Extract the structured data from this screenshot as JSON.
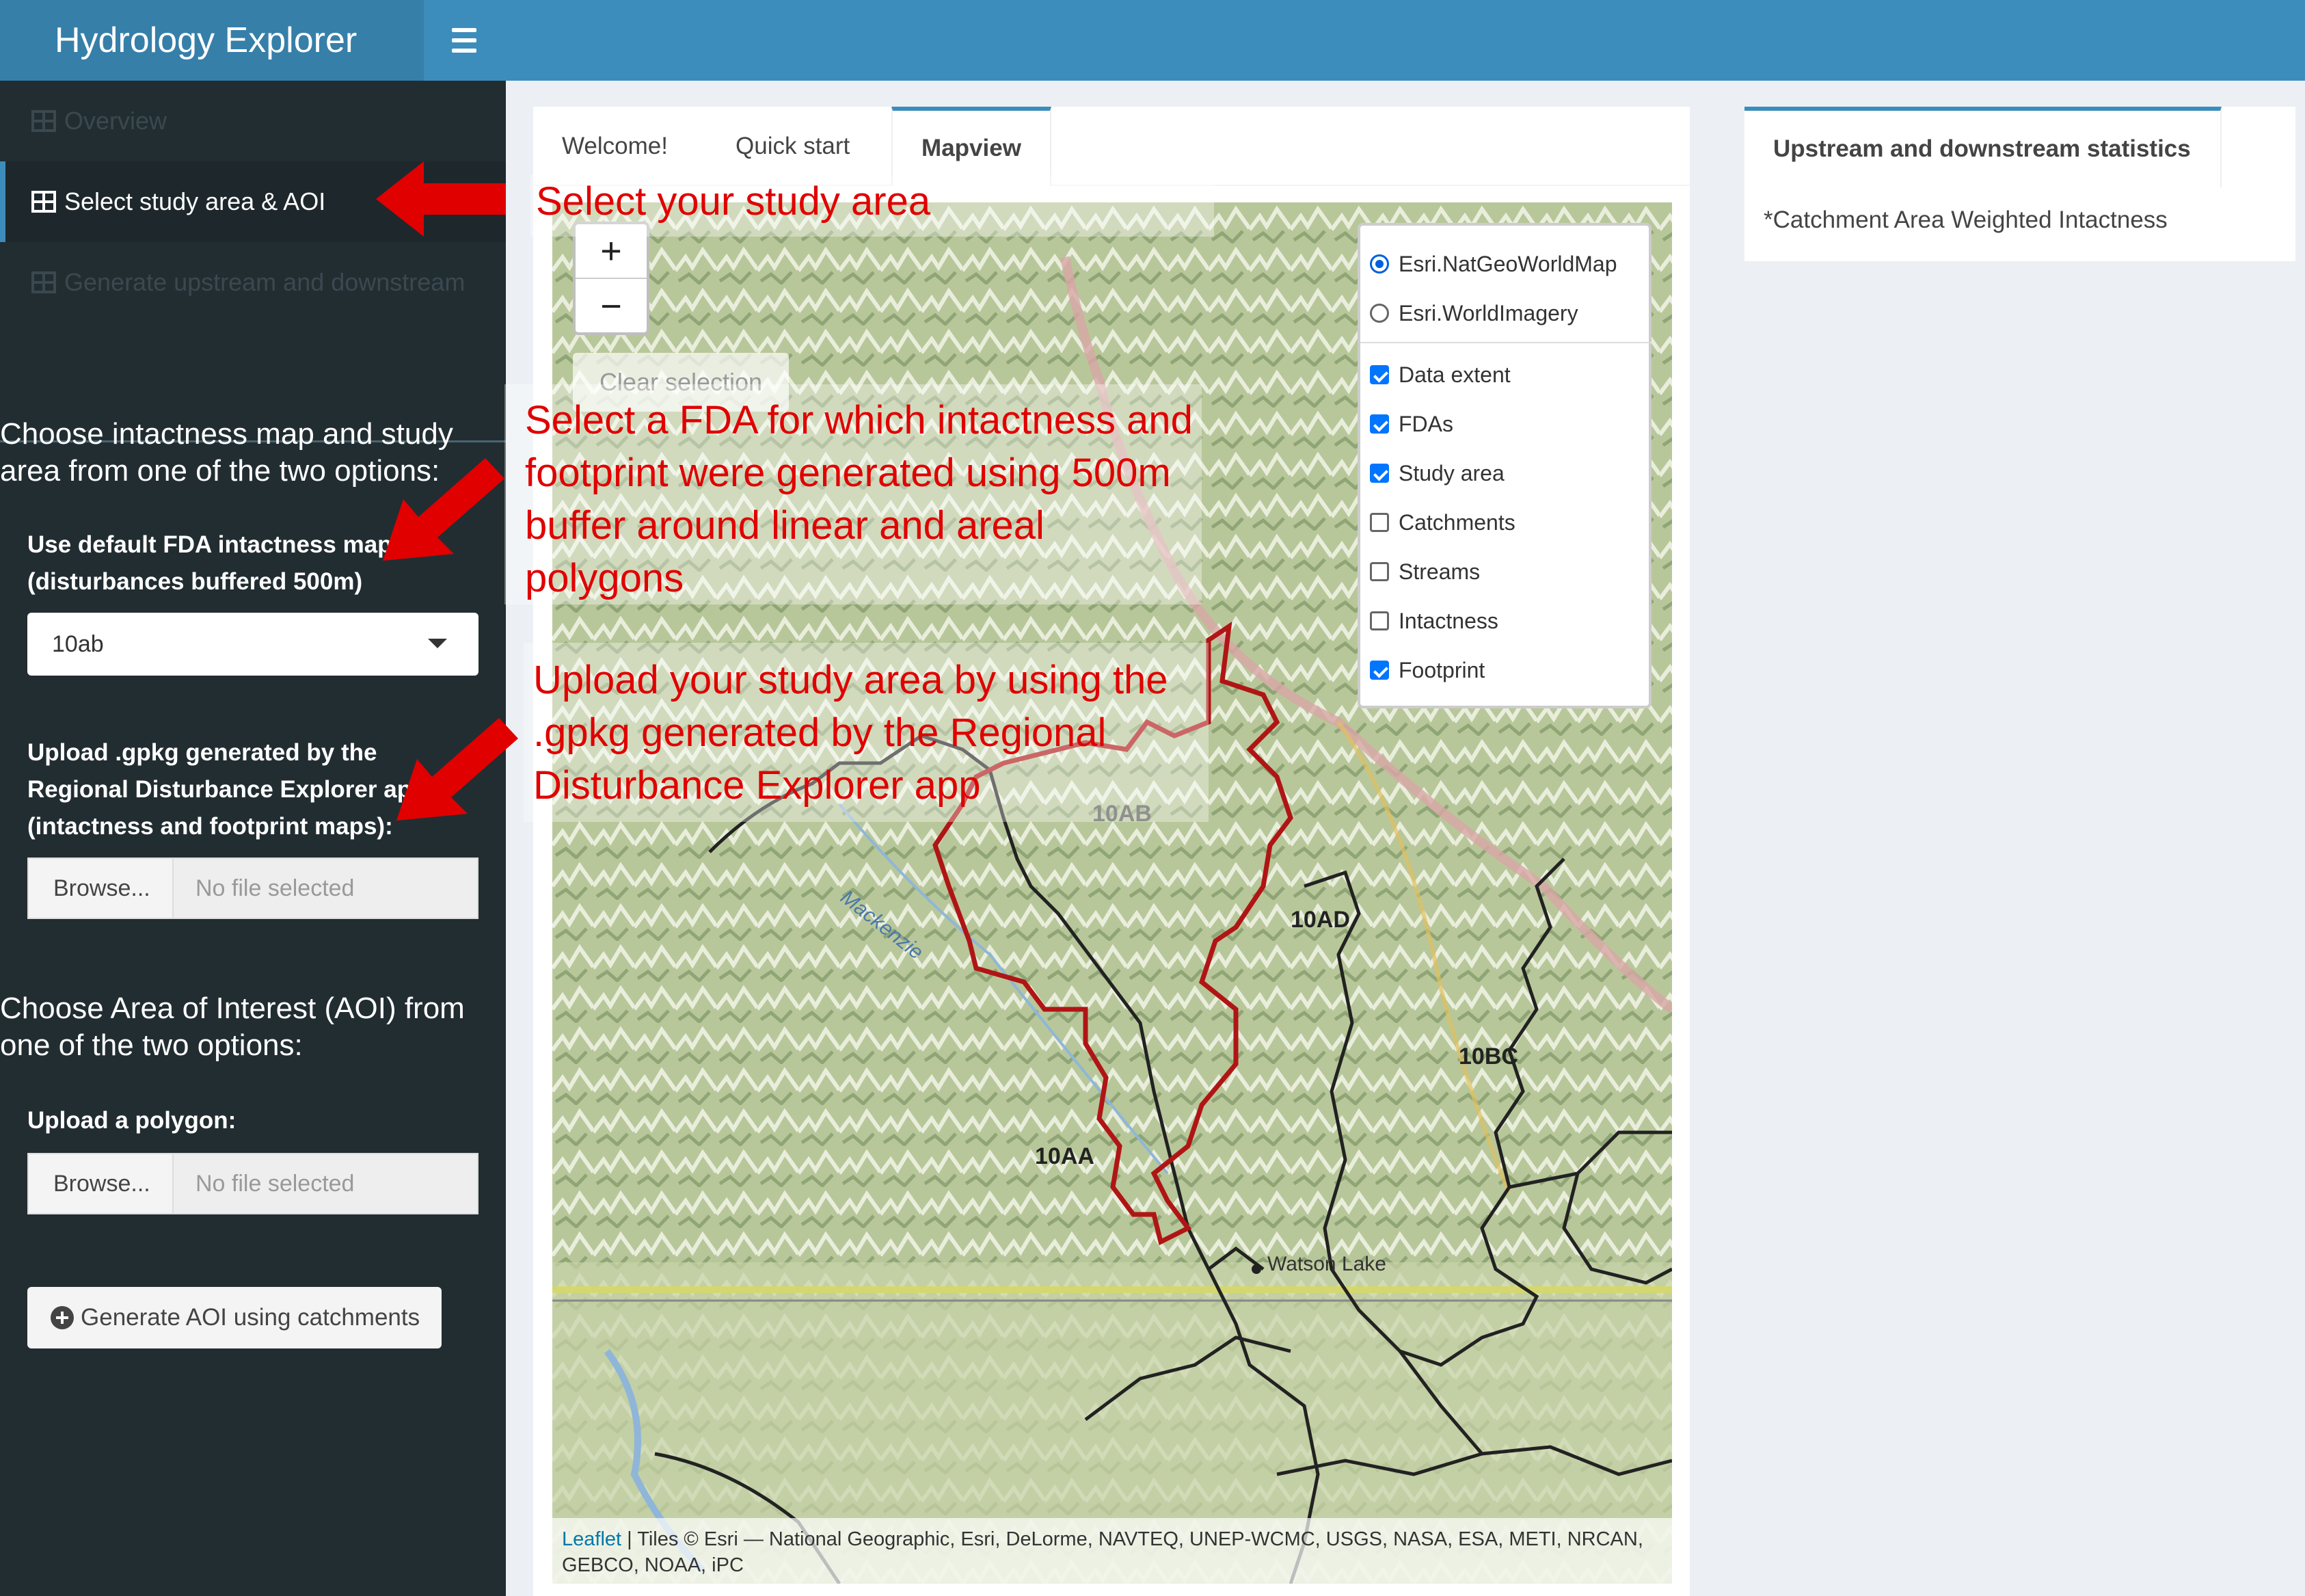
{
  "app_title": "Hydrology Explorer",
  "sidebar": {
    "menu": [
      {
        "label": "Overview",
        "state": "dim"
      },
      {
        "label": "Select study area & AOI",
        "state": "active"
      },
      {
        "label": "Generate upstream and downstream",
        "state": "dim"
      }
    ],
    "intactness_heading": "Choose intactness map and study area from one of the two options:",
    "default_fda_label": "Use default FDA intactness map (disturbances buffered 500m)",
    "fda_select_value": "10ab",
    "upload_gpkg_label": "Upload .gpkg generated by the Regional Disturbance Explorer app (intactness and footprint maps):",
    "browse_label": "Browse...",
    "no_file": "No file selected",
    "aoi_heading": "Choose Area of Interest (AOI) from one of the two options:",
    "upload_polygon_label": "Upload a polygon:",
    "generate_aoi_button": "Generate AOI using catchments"
  },
  "main": {
    "tabs": [
      "Welcome!",
      "Quick start",
      "Mapview"
    ],
    "active_tab": "Mapview",
    "map": {
      "zoom_in": "+",
      "zoom_out": "−",
      "clear_selection": "Clear selection",
      "basemaps": [
        {
          "label": "Esri.NatGeoWorldMap",
          "selected": true
        },
        {
          "label": "Esri.WorldImagery",
          "selected": false
        }
      ],
      "overlays": [
        {
          "label": "Data extent",
          "checked": true
        },
        {
          "label": "FDAs",
          "checked": true
        },
        {
          "label": "Study area",
          "checked": true
        },
        {
          "label": "Catchments",
          "checked": false
        },
        {
          "label": "Streams",
          "checked": false
        },
        {
          "label": "Intactness",
          "checked": false
        },
        {
          "label": "Footprint",
          "checked": true
        }
      ],
      "fda_labels": [
        "10AB",
        "10AD",
        "10BC",
        "10AA"
      ],
      "place_label": "Watson Lake",
      "river_label": "Mackenzie",
      "attribution_link": "Leaflet",
      "attribution_text": " | Tiles © Esri — National Geographic, Esri, DeLorme, NAVTEQ, UNEP-WCMC, USGS, NASA, ESA, METI, NRCAN, GEBCO, NOAA, iPC"
    }
  },
  "right_panel": {
    "tab": "Upstream and downstream statistics",
    "text": "*Catchment Area Weighted Intactness"
  },
  "annotations": {
    "study_area": "Select your study area",
    "fda": "Select a FDA for which intactness and footprint were generated using 500m buffer around linear and areal polygons",
    "upload": "Upload your study area by using the .gpkg generated by the Regional Disturbance Explorer app"
  },
  "colors": {
    "header": "#3c8dbc",
    "logo": "#367fa9",
    "sidebar": "#222d32",
    "study_area_outline": "#b01515",
    "annotation": "#e00000"
  }
}
